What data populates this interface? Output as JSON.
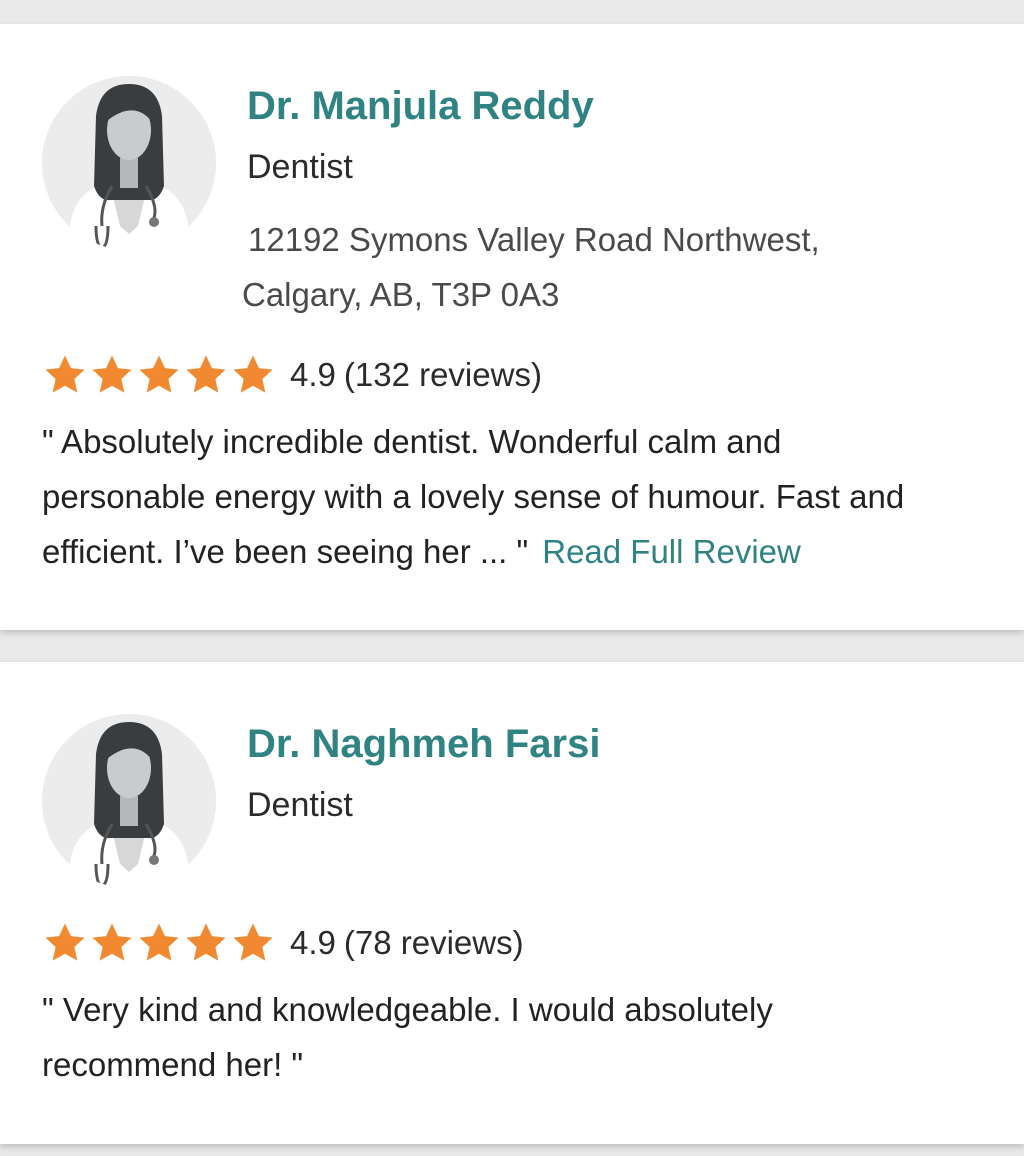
{
  "colors": {
    "accent": "#2f8383",
    "star": "#f0892f",
    "background": "#e9e9e9",
    "card": "#ffffff"
  },
  "icons": {
    "avatar": "doctor-female-avatar-icon",
    "star": "star-icon"
  },
  "doctors": [
    {
      "name": "Dr. Manjula Reddy",
      "specialty": "Dentist",
      "address_line1": "12192 Symons Valley Road Northwest,",
      "address_line2": "Calgary, AB, T3P 0A3",
      "rating": "4.9",
      "review_count": "(132 reviews)",
      "stars": 5,
      "quote_line1": "\" Absolutely incredible dentist. Wonderful calm and",
      "quote_line2": "personable energy with a lovely sense of humour. Fast and",
      "quote_line3": "efficient. I’ve been seeing her ... \"",
      "read_more": "Read Full Review"
    },
    {
      "name": "Dr. Naghmeh Farsi",
      "specialty": "Dentist",
      "rating": "4.9",
      "review_count": "(78 reviews)",
      "stars": 5,
      "quote_line1": "\" Very kind and knowledgeable. I would absolutely",
      "quote_line2": "recommend her! \""
    }
  ]
}
